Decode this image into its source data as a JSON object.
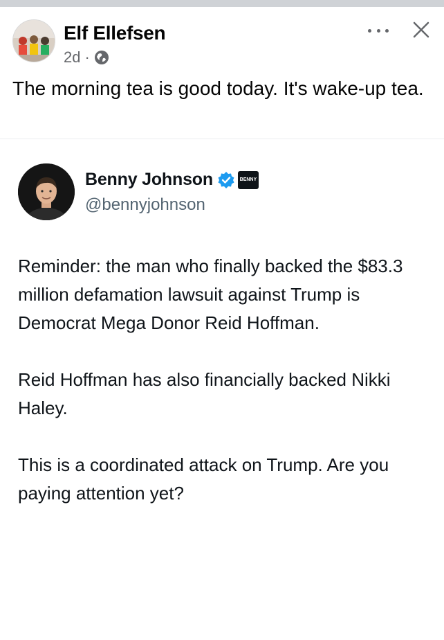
{
  "post": {
    "author": "Elf Ellefsen",
    "time": "2d",
    "separator": "·",
    "text": "The morning tea is good today. It's wake-up tea.",
    "privacy_icon": "globe-icon",
    "actions": {
      "more_icon": "more-icon",
      "close_icon": "close-icon"
    }
  },
  "shared_tweet": {
    "name": "Benny Johnson",
    "handle": "@bennyjohnson",
    "badges": [
      "verified-icon",
      "affiliate-badge"
    ],
    "affiliate_text": "BENNY",
    "paragraphs": [
      "Reminder: the man who finally backed the $83.3 million defamation lawsuit against Trump is Democrat Mega Donor Reid Hoffman.",
      "Reid Hoffman has also financially backed Nikki Haley.",
      "This is a coordinated attack on Trump. Are you paying attention yet?"
    ]
  },
  "colors": {
    "divider": "#cfd2d6",
    "meta_text": "#65676b",
    "handle_text": "#536471",
    "verified_blue": "#1d9bf0"
  }
}
